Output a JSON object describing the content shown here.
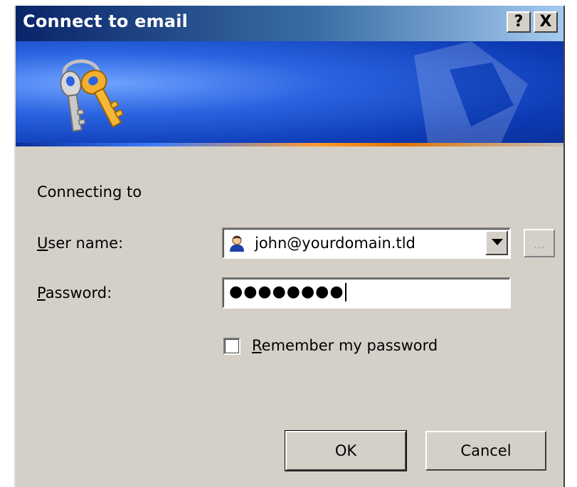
{
  "window": {
    "title": "Connect to email",
    "help_button": "?",
    "close_button": "X"
  },
  "header": {
    "icon": "keys-icon"
  },
  "form": {
    "connecting_label": "Connecting to",
    "username_label_accel": "U",
    "username_label_rest": "ser name:",
    "username_value": "john@yourdomain.tld",
    "username_icon": "user-icon",
    "browse_label": "...",
    "password_label_accel": "P",
    "password_label_rest": "assword:",
    "password_mask": "●●●●●●●●",
    "remember_accel": "R",
    "remember_rest": "emember my password",
    "remember_checked": false
  },
  "buttons": {
    "ok": "OK",
    "cancel": "Cancel"
  },
  "colors": {
    "title_bar": "#0a246a",
    "dialog_face": "#d4d0c8",
    "banner_blue": "#2a63e0",
    "accent_orange": "#ff9a2e"
  }
}
